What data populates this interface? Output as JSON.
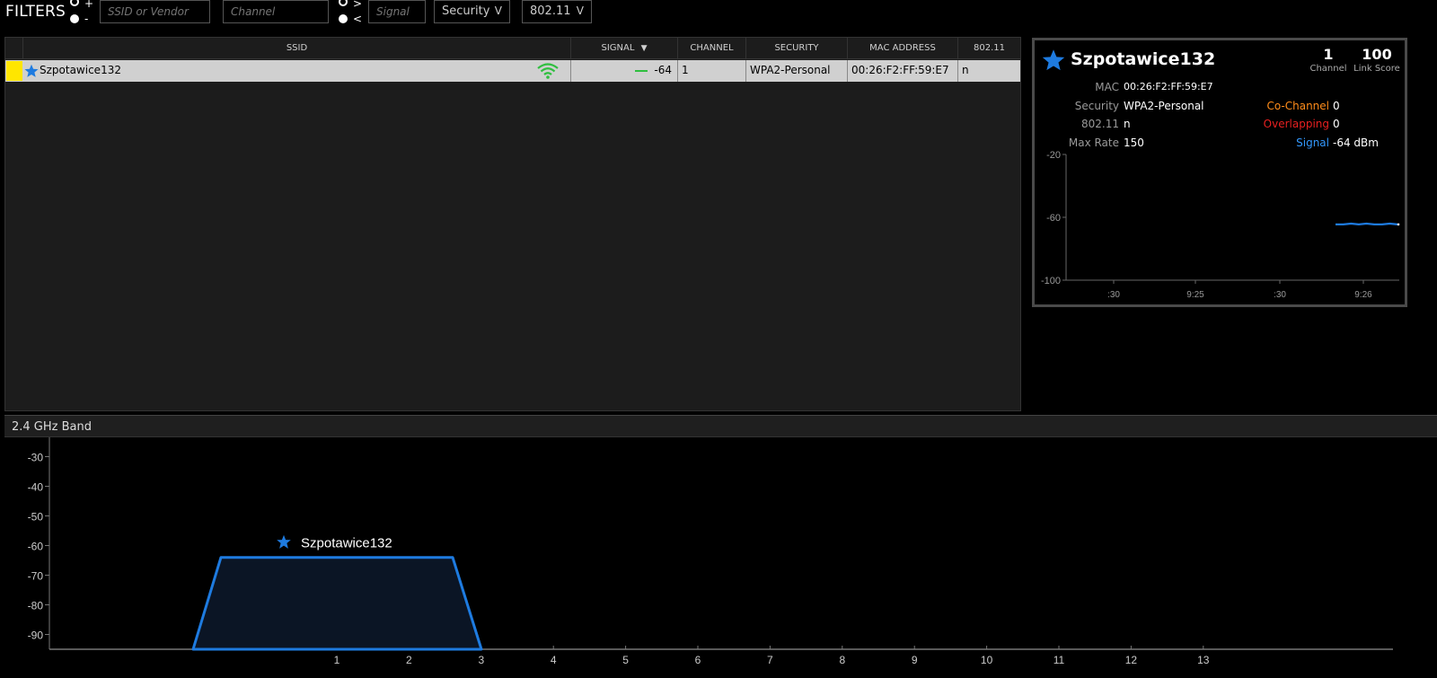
{
  "filters": {
    "label": "FILTERS",
    "plus": "+",
    "minus": "-",
    "gt": ">",
    "lt": "<",
    "ssid_placeholder": "SSID or Vendor",
    "channel_placeholder": "Channel",
    "signal_placeholder": "Signal",
    "security_label": "Security",
    "standard_label": "802.11",
    "chevron": "V"
  },
  "table": {
    "columns": [
      "SSID",
      "SIGNAL",
      "CHANNEL",
      "SECURITY",
      "MAC ADDRESS",
      "802.11"
    ],
    "sort_indicator": "▼",
    "rows": [
      {
        "color": "#ffe600",
        "ssid": "Szpotawice132",
        "signal": "-64",
        "channel": "1",
        "security": "WPA2-Personal",
        "mac": "00:26:F2:FF:59:E7",
        "standard": "n"
      }
    ]
  },
  "details": {
    "ssid": "Szpotawice132",
    "channel_value": "1",
    "channel_label": "Channel",
    "score_value": "100",
    "score_label": "Link Score",
    "mac_key": "MAC",
    "mac_val": "00:26:F2:FF:59:E7",
    "security_key": "Security",
    "security_val": "WPA2-Personal",
    "standard_key": "802.11",
    "standard_val": "n",
    "maxrate_key": "Max Rate",
    "maxrate_val": "150",
    "cochannel_key": "Co-Channel",
    "cochannel_val": "0",
    "overlapping_key": "Overlapping",
    "overlapping_val": "0",
    "signal_key": "Signal",
    "signal_val": "-64 dBm",
    "colors": {
      "cochannel": "#ff8c1a",
      "overlapping": "#e82020",
      "signal": "#3399ff"
    }
  },
  "band": {
    "title": "2.4 GHz Band"
  },
  "chart_data": [
    {
      "type": "line",
      "name": "signal-history",
      "ylim": [
        -100,
        -20
      ],
      "y_ticks": [
        "-20",
        "-60",
        "-100"
      ],
      "x_ticks": [
        ":30",
        "9:25",
        ":30",
        "9:26"
      ],
      "series": [
        {
          "name": "Szpotawice132",
          "color": "#1e7be0",
          "values": [
            -64.5,
            -64.5,
            -64.0,
            -64.5,
            -64.0,
            -64.5,
            -64.5,
            -64.0,
            -64.5
          ]
        }
      ]
    },
    {
      "type": "area",
      "name": "channel-graph",
      "ylim": [
        -95,
        -25
      ],
      "y_ticks": [
        "-30",
        "-40",
        "-50",
        "-60",
        "-70",
        "-80",
        "-90"
      ],
      "x_ticks": [
        "1",
        "2",
        "3",
        "4",
        "5",
        "6",
        "7",
        "8",
        "9",
        "10",
        "11",
        "12",
        "13"
      ],
      "networks": [
        {
          "ssid": "Szpotawice132",
          "channel": 1,
          "signal": -64,
          "color": "#1e7be0"
        }
      ]
    }
  ]
}
